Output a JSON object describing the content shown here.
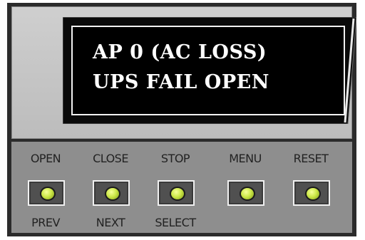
{
  "display": {
    "line1": "AP 0 (AC LOSS)",
    "line2": "UPS FAIL OPEN"
  },
  "buttons": [
    {
      "id": "open",
      "top_label": "OPEN",
      "bottom_label": "PREV",
      "led_color": "#cde84a"
    },
    {
      "id": "close",
      "top_label": "CLOSE",
      "bottom_label": "NEXT",
      "led_color": "#cde84a"
    },
    {
      "id": "stop",
      "top_label": "STOP",
      "bottom_label": "SELECT",
      "led_color": "#cde84a"
    },
    {
      "id": "menu",
      "top_label": "MENU",
      "bottom_label": "",
      "led_color": "#cde84a"
    },
    {
      "id": "reset",
      "top_label": "RESET",
      "bottom_label": "",
      "led_color": "#cde84a"
    }
  ],
  "colors": {
    "panel_upper": "#c6c6c6",
    "panel_lower": "#8e8e8e",
    "lcd_background": "#000000",
    "lcd_text": "#ffffff",
    "frame": "#2b2b2b"
  }
}
